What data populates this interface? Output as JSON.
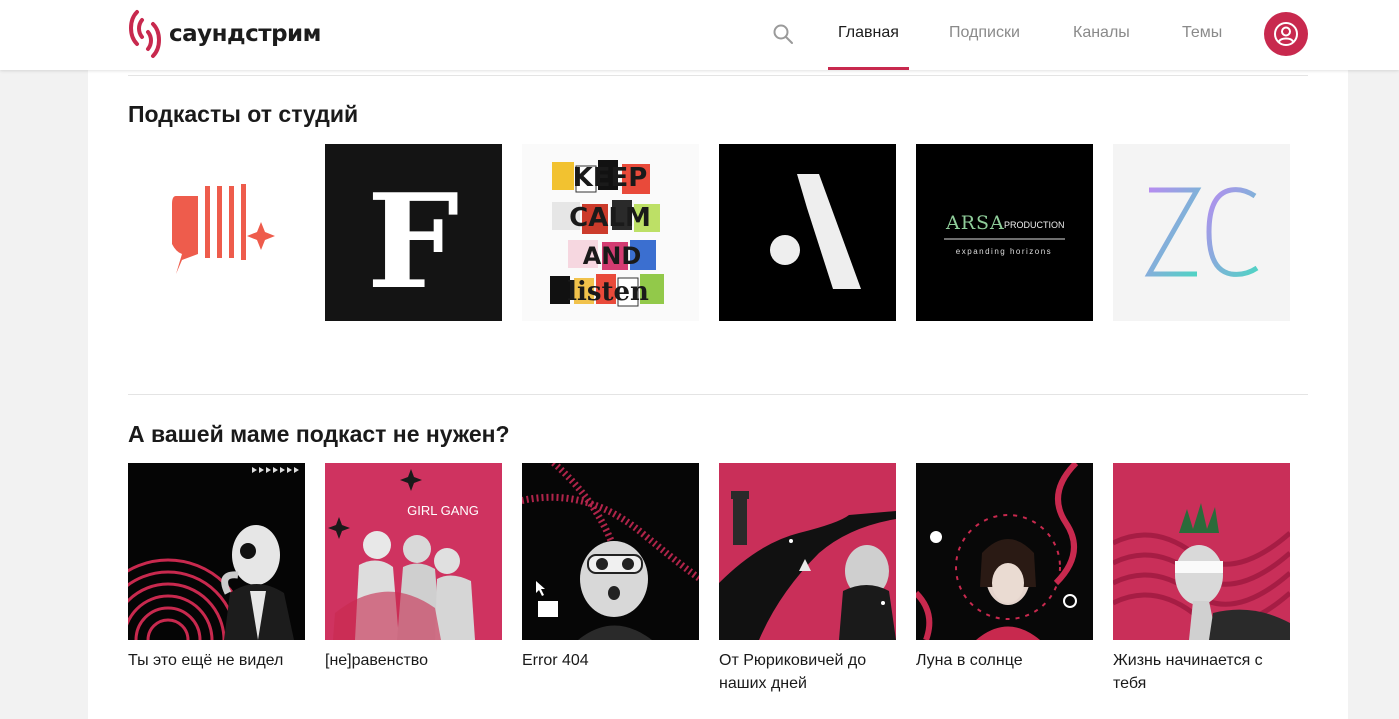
{
  "header": {
    "logo_text": "саундстрим",
    "nav": [
      "Главная",
      "Подписки",
      "Каналы",
      "Темы"
    ],
    "active_nav": "Главная",
    "accent": "#c8294e"
  },
  "studios_section": {
    "title": "Подкасты от студий",
    "tiles": [
      {
        "icon": "studio-logo-red-bars"
      },
      {
        "letter": "F"
      },
      {
        "lines": [
          "KEEP",
          "CALM",
          "AND",
          "listen"
        ]
      },
      {
        "letter": "A"
      },
      {
        "name": "ARSA",
        "suffix": "PRODUCTION",
        "tagline": "expanding horizons"
      },
      {
        "letters": "ZC"
      }
    ]
  },
  "moms_section": {
    "title": "А вашей маме подкаст не нужен?",
    "podcasts": [
      {
        "title": "Ты это ещё не видел"
      },
      {
        "title": "[не]равенство",
        "art_text": "GIRL GANG"
      },
      {
        "title": "Error 404"
      },
      {
        "title": "От Рюриковичей до наших дней"
      },
      {
        "title": "Луна в солнце"
      },
      {
        "title": "Жизнь начинается с тебя"
      }
    ]
  }
}
